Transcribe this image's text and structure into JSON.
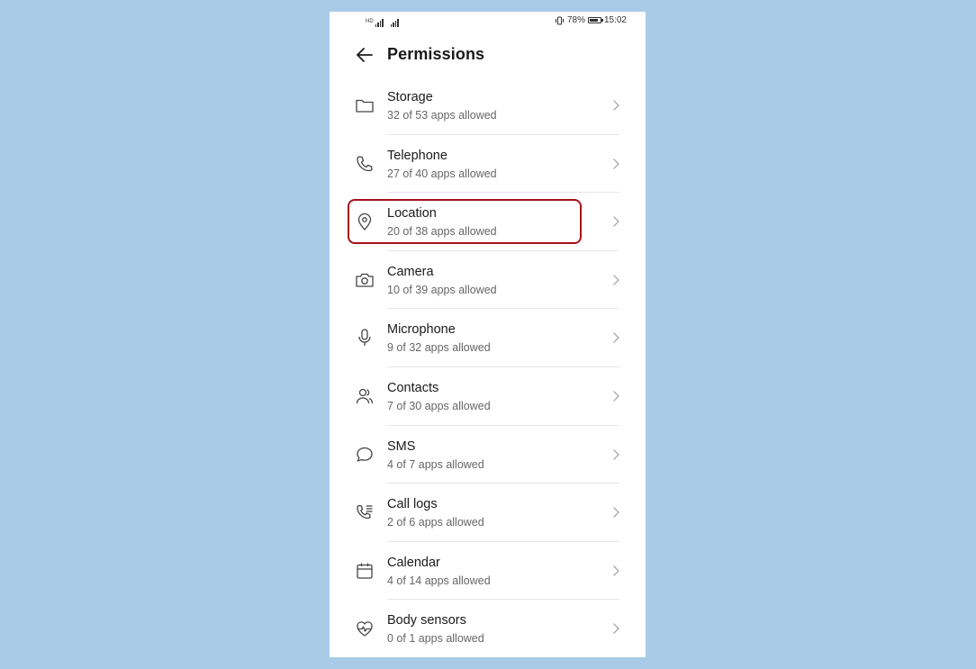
{
  "status_bar": {
    "hd_label": "HD",
    "battery_percent": "78%",
    "battery_level": 0.78,
    "time": "15:02"
  },
  "header": {
    "title": "Permissions",
    "back_icon": "back-arrow-icon"
  },
  "permissions": [
    {
      "label": "Storage",
      "subtitle": "32 of 53 apps allowed",
      "icon": "folder-icon"
    },
    {
      "label": "Telephone",
      "subtitle": "27 of 40 apps allowed",
      "icon": "phone-icon"
    },
    {
      "label": "Location",
      "subtitle": "20 of 38 apps allowed",
      "icon": "location-pin-icon"
    },
    {
      "label": "Camera",
      "subtitle": "10 of 39 apps allowed",
      "icon": "camera-icon"
    },
    {
      "label": "Microphone",
      "subtitle": "9 of 32 apps allowed",
      "icon": "microphone-icon"
    },
    {
      "label": "Contacts",
      "subtitle": "7 of 30 apps allowed",
      "icon": "contacts-icon"
    },
    {
      "label": "SMS",
      "subtitle": "4 of 7 apps allowed",
      "icon": "message-bubble-icon"
    },
    {
      "label": "Call logs",
      "subtitle": "2 of 6 apps allowed",
      "icon": "call-log-icon"
    },
    {
      "label": "Calendar",
      "subtitle": "4 of 14 apps allowed",
      "icon": "calendar-icon"
    },
    {
      "label": "Body sensors",
      "subtitle": "0 of 1 apps allowed",
      "icon": "heart-rate-icon"
    }
  ],
  "colors": {
    "background": "#a9cbe8",
    "highlight": "#a8121a",
    "text_primary": "#1a1a1a",
    "text_secondary": "#666666"
  }
}
